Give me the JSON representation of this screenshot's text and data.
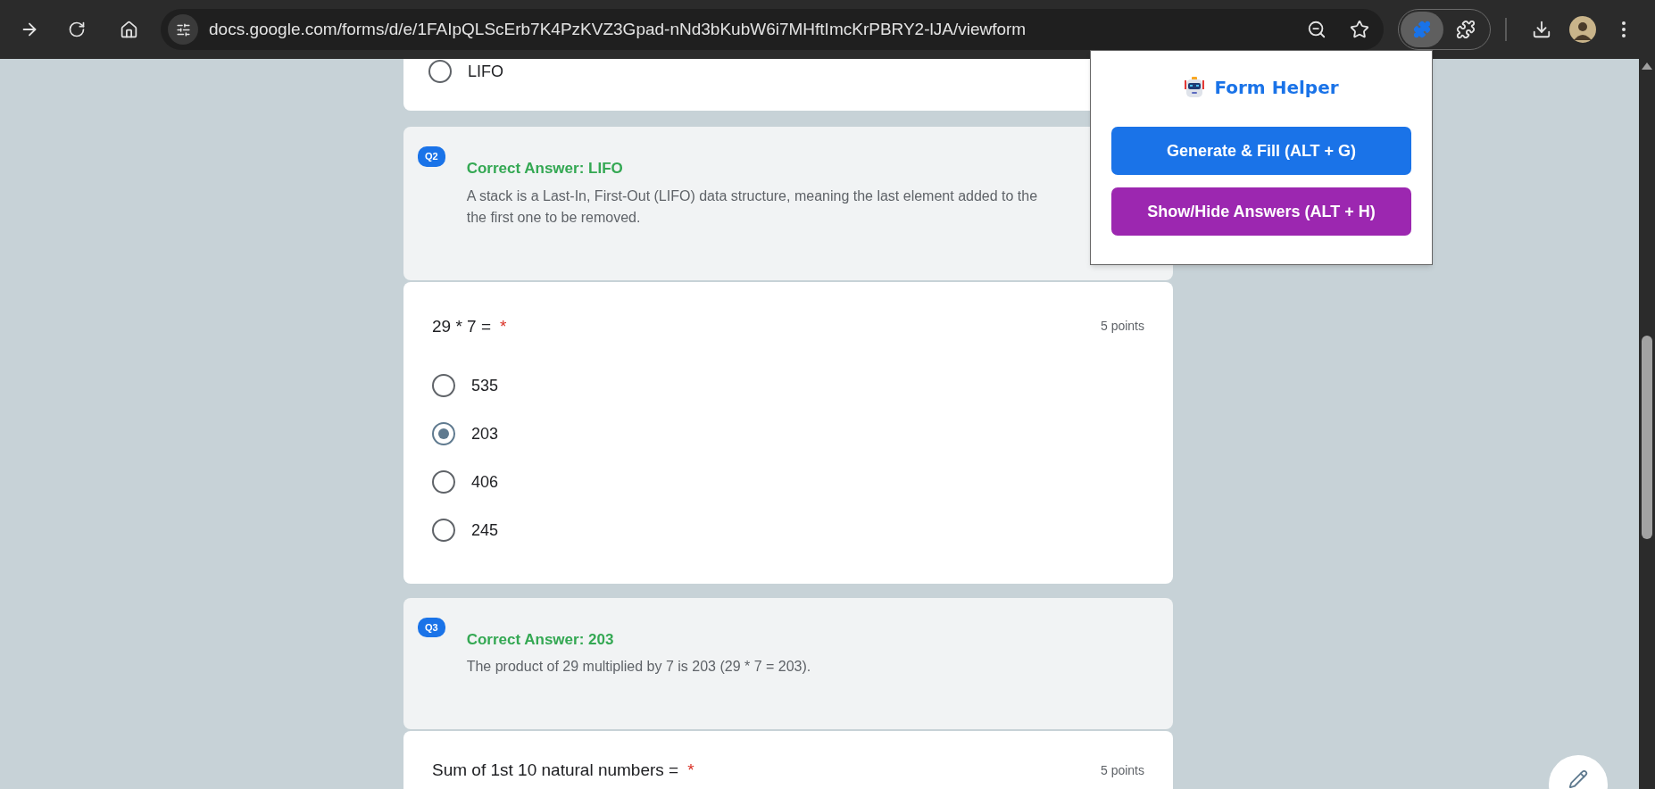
{
  "browser": {
    "url": "docs.google.com/forms/d/e/1FAIpQLScErb7K4PzKVZ3Gpad-nNd3bKubW6i7MHftImcKrPBRY2-lJA/viewform"
  },
  "extension_popup": {
    "title": "Form Helper",
    "buttons": [
      {
        "label": "Generate & Fill (ALT + G)",
        "color": "#1a73e8"
      },
      {
        "label": "Show/Hide Answers (ALT + H)",
        "color": "#9c27b0"
      }
    ]
  },
  "form": {
    "items": [
      {
        "kind": "question_tail",
        "options": [
          {
            "label": "LIFO",
            "selected": false
          }
        ]
      },
      {
        "kind": "answer",
        "badge": "Q2",
        "answer": "Correct Answer: LIFO",
        "explanation_lines": [
          "A stack is a Last-In, First-Out (LIFO) data structure, meaning the last element added to the",
          "the first one to be removed."
        ]
      },
      {
        "kind": "question",
        "title": "29 * 7 =",
        "required_mark": "*",
        "points": "5 points",
        "options": [
          {
            "label": "535",
            "selected": false
          },
          {
            "label": "203",
            "selected": true
          },
          {
            "label": "406",
            "selected": false
          },
          {
            "label": "245",
            "selected": false
          }
        ]
      },
      {
        "kind": "answer",
        "badge": "Q3",
        "answer": "Correct Answer: 203",
        "explanation_lines": [
          "The product of 29 multiplied by 7 is 203 (29 * 7 = 203)."
        ]
      },
      {
        "kind": "question_head",
        "title": "Sum of 1st 10 natural numbers =",
        "required_mark": "*",
        "points": "5 points"
      }
    ]
  }
}
